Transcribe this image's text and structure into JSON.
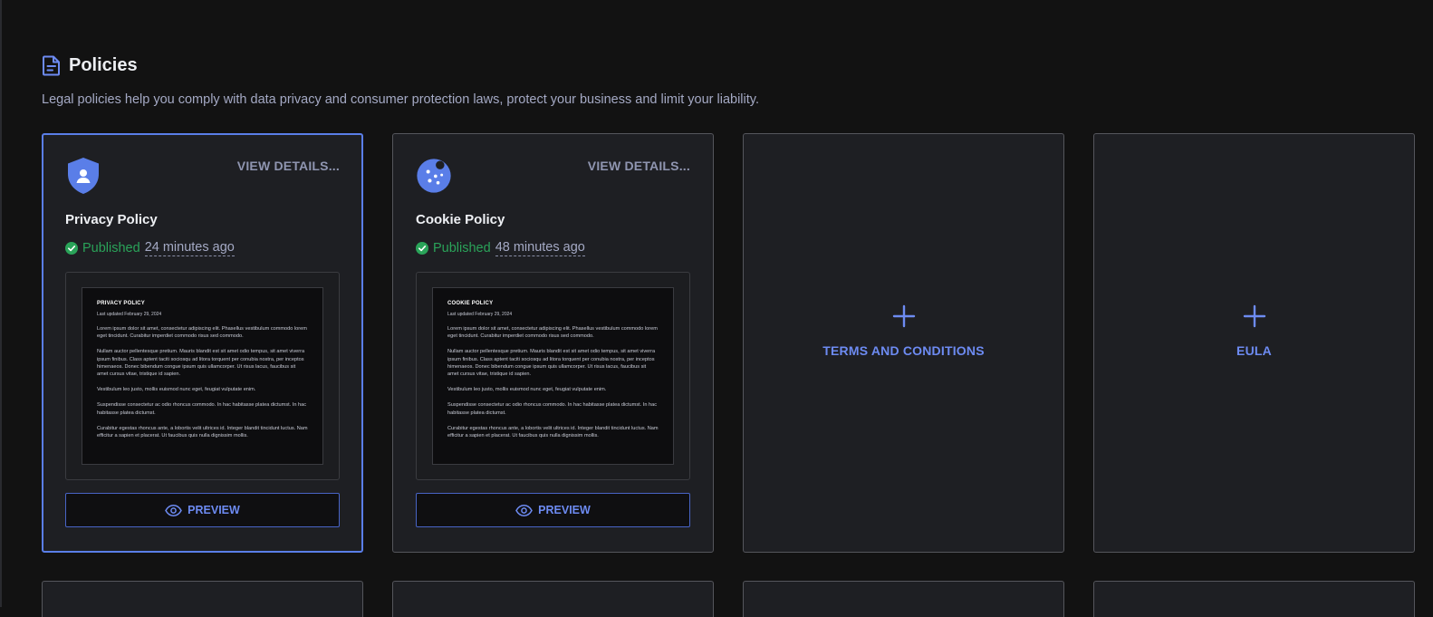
{
  "header": {
    "title": "Policies",
    "subtitle": "Legal policies help you comply with data privacy and consumer protection laws, protect your business and limit your liability."
  },
  "colors": {
    "accent": "#5a7ee8",
    "published": "#2aa359",
    "background": "#121212",
    "card": "#1e1f23"
  },
  "cards": [
    {
      "title": "Privacy Policy",
      "icon": "shield-user-icon",
      "view_details": "VIEW DETAILS...",
      "status": "Published",
      "time": "24 minutes ago",
      "preview_label": "PREVIEW",
      "doc": {
        "title": "PRIVACY POLICY",
        "date": "Last updated February 29, 2024",
        "paragraphs": [
          "Lorem ipsum dolor sit amet, consectetur adipiscing elit. Phasellus vestibulum commodo lorem eget tincidunt. Curabitur imperdiet commodo risus sed commodo.",
          "Nullam auctor pellentesque pretium. Mauris blandit est sit amet odio tempus, sit amet viverra ipsum finibus. Class aptent taciti sociosqu ad litora torquent per conubia nostra, per inceptos himenaeos. Donec bibendum congue ipsum quis ullamcorper. Ut risus lacus, faucibus sit amet cursus vitae, tristique id sapien.",
          "Vestibulum leo justo, mollis euismod nunc eget, feugiat vulputate enim.",
          "Suspendisse consectetur ac odio rhoncus commodo. In hac habitasse platea dictumst. In hac habitasse platea dictumst.",
          "Curabitur egestas rhoncus ante, a lobortis velit ultrices id. Integer blandit tincidunt luctus. Nam efficitur a sapien et placerat. Ut faucibus quis nulla dignissim mollis."
        ]
      }
    },
    {
      "title": "Cookie Policy",
      "icon": "cookie-icon",
      "view_details": "VIEW DETAILS...",
      "status": "Published",
      "time": "48 minutes ago",
      "preview_label": "PREVIEW",
      "doc": {
        "title": "COOKIE POLICY",
        "date": "Last updated February 29, 2024",
        "paragraphs": [
          "Lorem ipsum dolor sit amet, consectetur adipiscing elit. Phasellus vestibulum commodo lorem eget tincidunt. Curabitur imperdiet commodo risus sed commodo.",
          "Nullam auctor pellentesque pretium. Mauris blandit est sit amet odio tempus, sit amet viverra ipsum finibus. Class aptent taciti sociosqu ad litora torquent per conubia nostra, per inceptos himenaeos. Donec bibendum congue ipsum quis ullamcorper. Ut risus lacus, faucibus sit amet cursus vitae, tristique id sapien.",
          "Vestibulum leo justo, mollis euismod nunc eget, feugiat vulputate enim.",
          "Suspendisse consectetur ac odio rhoncus commodo. In hac habitasse platea dictumst. In hac habitasse platea dictumst.",
          "Curabitur egestas rhoncus ante, a lobortis velit ultrices id. Integer blandit tincidunt luctus. Nam efficitur a sapien et placerat. Ut faucibus quis nulla dignissim mollis."
        ]
      }
    }
  ],
  "add_cards": [
    {
      "label": "TERMS AND CONDITIONS",
      "icon": "plus-icon"
    },
    {
      "label": "EULA",
      "icon": "plus-icon"
    }
  ]
}
